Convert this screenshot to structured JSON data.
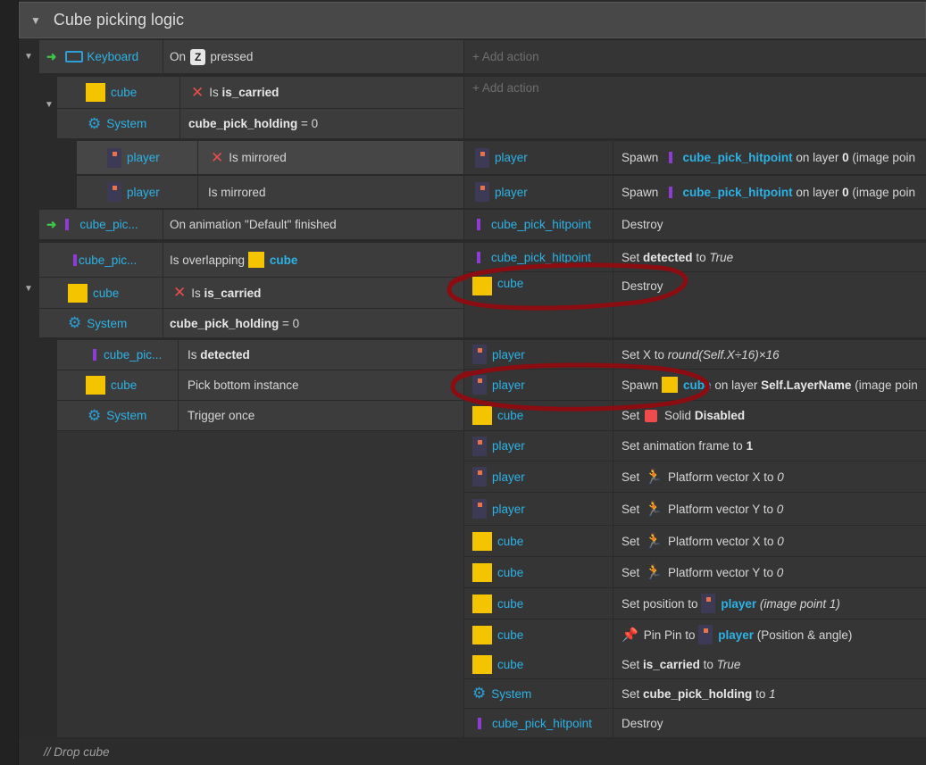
{
  "group": {
    "title": "Cube picking logic"
  },
  "add_action": "+ Add action",
  "e1": {
    "trigger_obj": "Keyboard",
    "trigger_on": "On",
    "trigger_key": "Z",
    "trigger_after": "pressed",
    "sub": {
      "c1_obj": "cube",
      "c1_is": "Is",
      "c1_var": "is_carried",
      "c2_obj": "System",
      "c2_var": "cube_pick_holding",
      "c2_rest": "= 0",
      "s1": {
        "obj": "player",
        "cond": "Is mirrored",
        "act_obj": "player",
        "act_verb": "Spawn",
        "act_target": "cube_pick_hitpoint",
        "act_on": "on layer",
        "act_layer": "0",
        "act_rest": "(image poin"
      },
      "s2": {
        "obj": "player",
        "cond": "Is mirrored",
        "act_obj": "player",
        "act_verb": "Spawn",
        "act_target": "cube_pick_hitpoint",
        "act_on": "on layer",
        "act_layer": "0",
        "act_rest": "(image poin"
      }
    }
  },
  "e2": {
    "obj": "cube_pic...",
    "cond": "On animation \"Default\" finished",
    "act_obj": "cube_pick_hitpoint",
    "act": "Destroy"
  },
  "e3": {
    "c1_obj": "cube_pic...",
    "c1_text": "Is overlapping",
    "c1_target": "cube",
    "c2_obj": "cube",
    "c2_is": "Is",
    "c2_var": "is_carried",
    "c3_obj": "System",
    "c3_var": "cube_pick_holding",
    "c3_rest": "= 0",
    "a1_obj": "cube_pick_hitpoint",
    "a1_set": "Set",
    "a1_var": "detected",
    "a1_to": "to",
    "a1_val": "True",
    "a2_obj": "cube",
    "a2_act": "Destroy"
  },
  "e4": {
    "c1_obj": "cube_pic...",
    "c1_is": "Is",
    "c1_var": "detected",
    "c2_obj": "cube",
    "c2_text": "Pick bottom instance",
    "c3_obj": "System",
    "c3_text": "Trigger once",
    "actions": [
      {
        "obj": "player",
        "pre": "Set X to",
        "val": "round(Self.X÷16)×16"
      },
      {
        "obj": "player",
        "pre": "Spawn",
        "target": "cube",
        "mid": "on layer",
        "layer": "Self.LayerName",
        "rest": "(image poin"
      },
      {
        "obj": "cube",
        "pre": "Set",
        "beh": "Solid",
        "val": "Disabled"
      },
      {
        "obj": "player",
        "pre": "Set animation frame to",
        "val": "1"
      },
      {
        "obj": "player",
        "pre": "Set",
        "beh": "Platform vector X to",
        "val": "0"
      },
      {
        "obj": "player",
        "pre": "Set",
        "beh": "Platform vector Y to",
        "val": "0"
      },
      {
        "obj": "cube",
        "pre": "Set",
        "beh": "Platform vector X to",
        "val": "0"
      },
      {
        "obj": "cube",
        "pre": "Set",
        "beh": "Platform vector Y to",
        "val": "0"
      },
      {
        "obj": "cube",
        "pre": "Set position to",
        "target": "player",
        "rest": "(image point 1)"
      },
      {
        "obj": "cube",
        "pre": "Pin Pin to",
        "target": "player",
        "rest": "(Position & angle)"
      },
      {
        "obj": "cube",
        "pre": "Set",
        "var": "is_carried",
        "to": "to",
        "val": "True"
      },
      {
        "obj": "System",
        "pre": "Set",
        "var": "cube_pick_holding",
        "to": "to",
        "val": "1"
      },
      {
        "obj": "cube_pick_hitpoint",
        "pre": "Destroy"
      }
    ]
  },
  "comment": "//  Drop cube",
  "colors": {
    "accent": "#2db2e5",
    "annotation": "#8b0d12",
    "cube": "#f5c400",
    "trigger": "#3fc54a"
  }
}
